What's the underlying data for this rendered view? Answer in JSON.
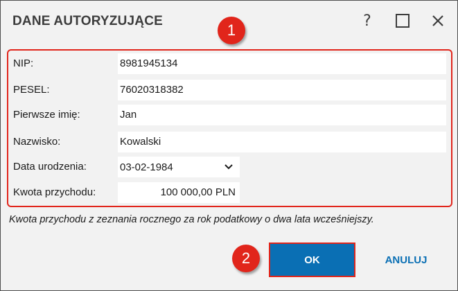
{
  "dialog": {
    "title": "DANE AUTORYZUJĄCE",
    "help_label": "?",
    "maximize_icon": "maximize-icon",
    "close_icon": "close-icon"
  },
  "callouts": {
    "one": "1",
    "two": "2",
    "color": "#e1251b"
  },
  "form": {
    "nip": {
      "label": "NIP:",
      "value": "8981945134"
    },
    "pesel": {
      "label": "PESEL:",
      "value": "76020318382"
    },
    "first_name": {
      "label": "Pierwsze imię:",
      "value": "Jan"
    },
    "last_name": {
      "label": "Nazwisko:",
      "value": "Kowalski"
    },
    "birth_date": {
      "label": "Data urodzenia:",
      "value": "03-02-1984"
    },
    "income": {
      "label": "Kwota przychodu:",
      "value": "100 000,00 PLN"
    }
  },
  "hint": "Kwota przychodu z zeznania rocznego za rok podatkowy o dwa lata wcześniejszy.",
  "buttons": {
    "ok": "OK",
    "cancel": "ANULUJ"
  },
  "colors": {
    "accent": "#0a6fb4",
    "highlight": "#e1251b",
    "background": "#f2f2f2"
  }
}
